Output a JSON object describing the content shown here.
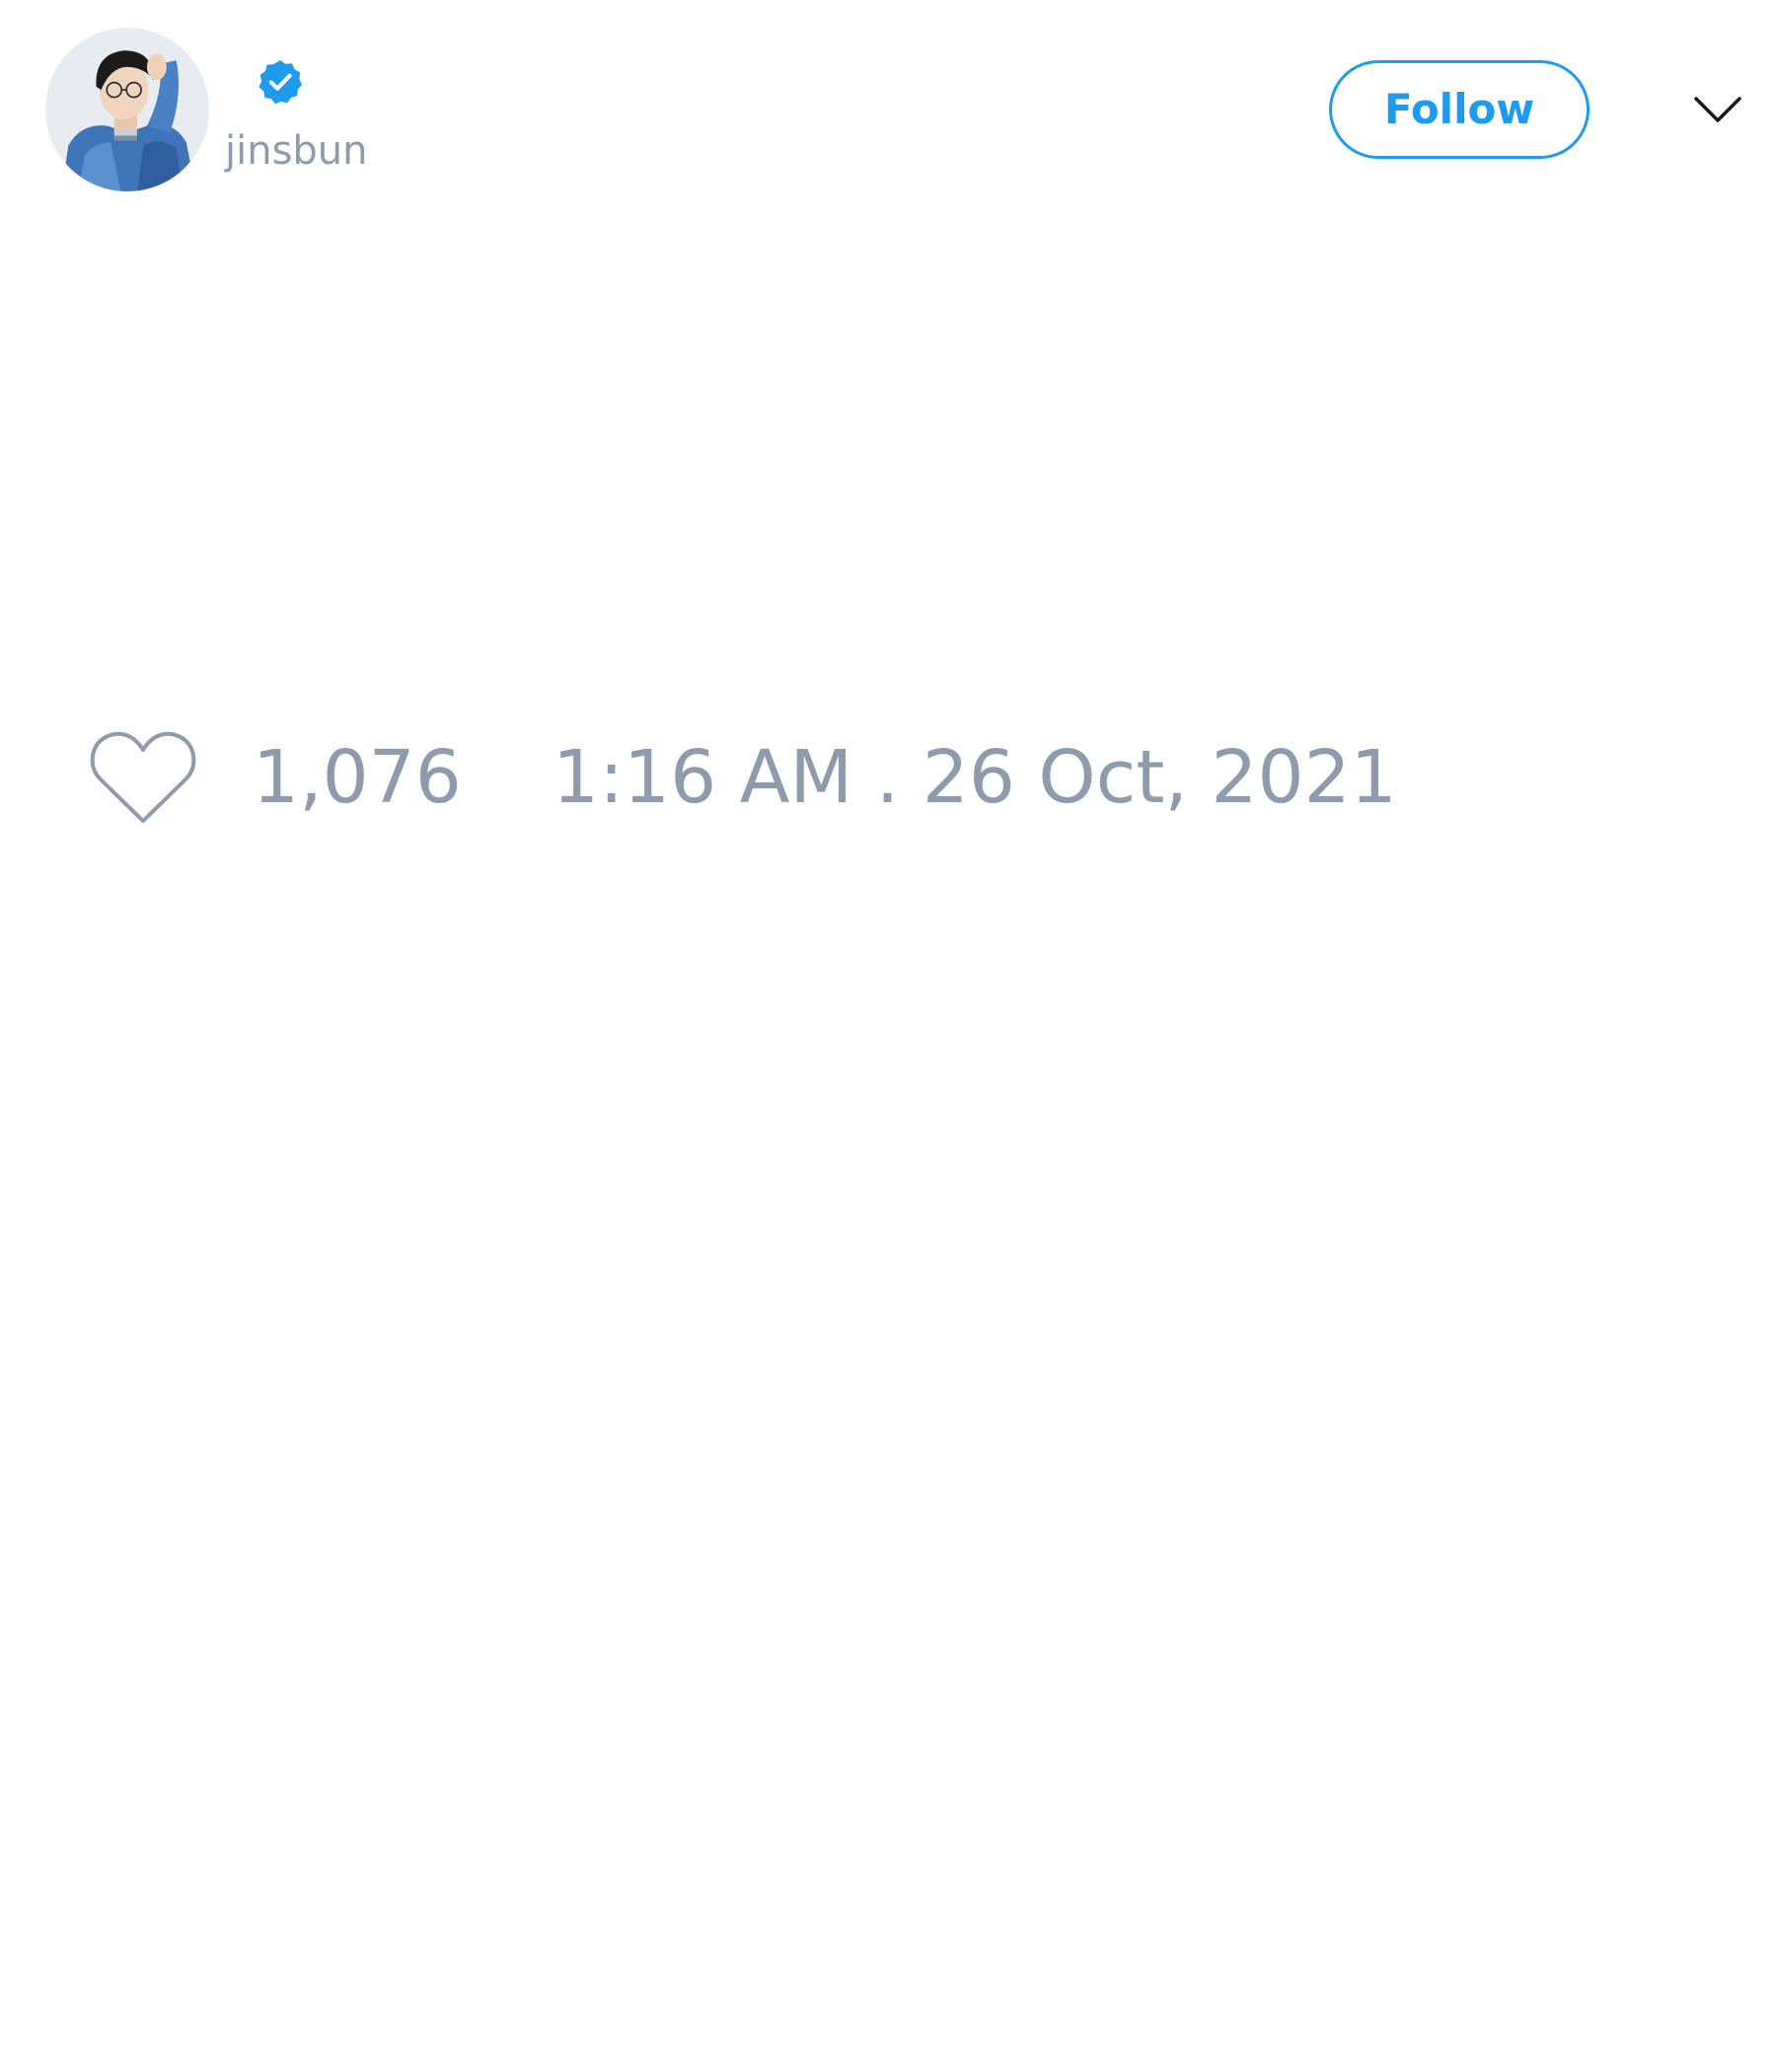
{
  "header": {
    "avatar_icon": "profile-photo",
    "verified_icon": "verified-badge-icon",
    "handle": "jinsbun",
    "follow_label": "Follow",
    "menu_icon": "chevron-down-icon"
  },
  "tweet": {
    "like_icon": "heart-icon",
    "like_count": "1,076",
    "timestamp": "1:16 AM . 26 Oct, 2021"
  },
  "colors": {
    "accent": "#1d9bf0",
    "muted_text": "#8e9bad",
    "background": "#ffffff"
  }
}
